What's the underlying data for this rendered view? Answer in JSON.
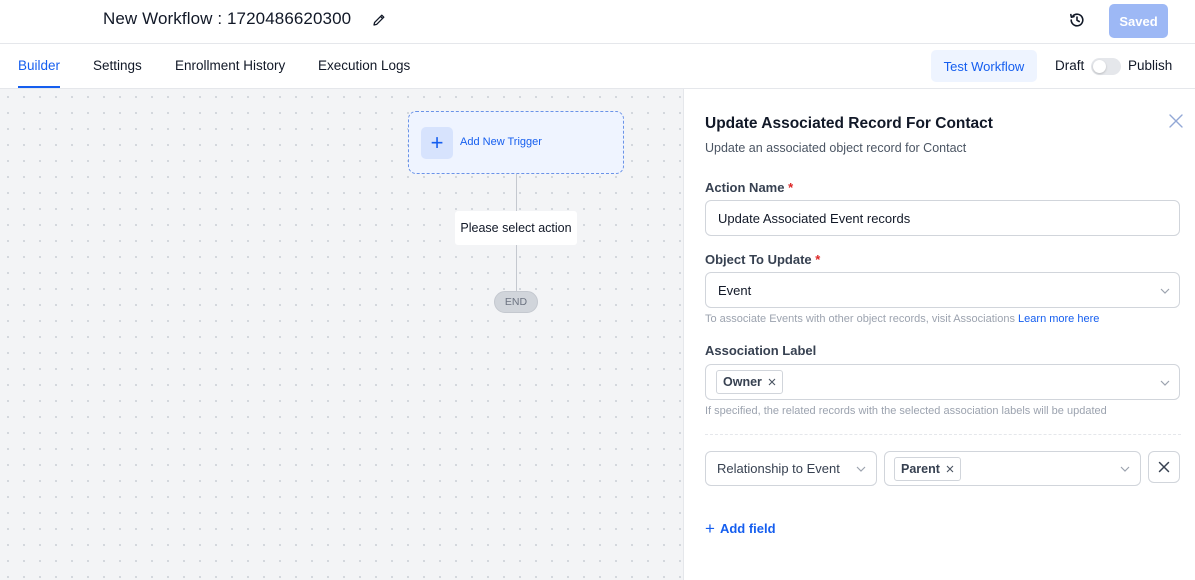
{
  "header": {
    "title": "New Workflow : 1720486620300",
    "saved_label": "Saved"
  },
  "tabs": [
    {
      "label": "Builder",
      "active": true
    },
    {
      "label": "Settings"
    },
    {
      "label": "Enrollment History"
    },
    {
      "label": "Execution Logs"
    }
  ],
  "toolbar": {
    "test_label": "Test Workflow",
    "draft_label": "Draft",
    "publish_label": "Publish",
    "publish_toggle_on": false
  },
  "canvas": {
    "trigger_label": "Add New Trigger",
    "action_label": "Please select action",
    "end_label": "END"
  },
  "panel": {
    "title": "Update Associated Record For Contact",
    "subtitle": "Update an associated object record for Contact",
    "action_name_label": "Action Name",
    "action_name_value": "Update Associated Event records",
    "object_label": "Object To Update",
    "object_value": "Event",
    "object_hint": "To associate Events with other object records, visit Associations",
    "object_hint_link": "Learn more here",
    "assoc_label": "Association Label",
    "assoc_chip": "Owner",
    "assoc_hint": "If specified, the related records with the selected association labels will be updated",
    "relationship_value": "Relationship to Event",
    "relationship_chip": "Parent",
    "add_field_label": "Add field"
  },
  "colors": {
    "accent": "#155eef",
    "saved_button": "#9db8f5",
    "required": "#dc2626"
  }
}
